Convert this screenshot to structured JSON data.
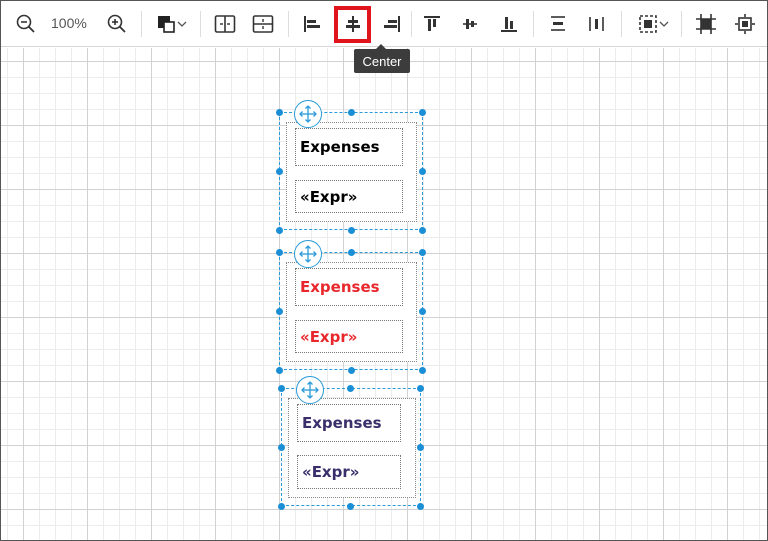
{
  "toolbar": {
    "zoom_text": "100%",
    "tooltip": "Center",
    "icons": [
      "zoom-out-icon",
      "zoom-in-icon",
      "fill-color-icon",
      "chevron-down-icon",
      "insert-column-icon",
      "insert-row-icon",
      "align-left-icon",
      "align-center-icon",
      "align-right-icon",
      "align-top-icon",
      "align-middle-icon",
      "align-bottom-icon",
      "distribute-horizontal-icon",
      "distribute-vertical-icon",
      "select-icon",
      "chevron-down-icon",
      "crop-icon",
      "resize-icon"
    ]
  },
  "groups": [
    {
      "title": "Expenses",
      "expr": "«Expr»",
      "color": "#000000"
    },
    {
      "title": "Expenses",
      "expr": "«Expr»",
      "color": "#e8282c"
    },
    {
      "title": "Expenses",
      "expr": "«Expr»",
      "color": "#3b2f6b"
    }
  ],
  "colors": {
    "highlight": "#e0141b",
    "selection": "#2a9bd8"
  }
}
